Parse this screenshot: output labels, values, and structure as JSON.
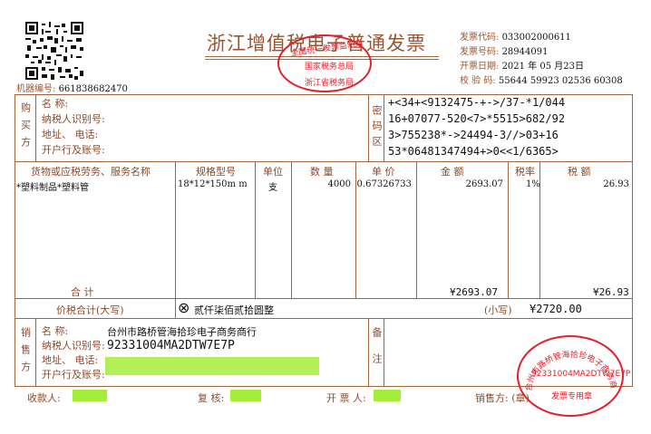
{
  "header": {
    "title": "浙江增值税电子普通发票",
    "machine_no_label": "机器编号:",
    "machine_no": "661838682470",
    "meta": [
      {
        "label": "发票代码:",
        "value": "033002000611"
      },
      {
        "label": "发票号码:",
        "value": "28944091"
      },
      {
        "label": "开票日期:",
        "value": "2021 年 05 月23日"
      },
      {
        "label": "校 验 码:",
        "value": "55644 59923 02536 60308"
      }
    ]
  },
  "buyer": {
    "section": "购买方",
    "labels": [
      "名      称:",
      "纳税人识别号:",
      "地址、 电话:",
      "开户行及账号:"
    ]
  },
  "cipher": {
    "section": "密码区",
    "lines": [
      "+<34+<9132475-+->/37-*1/044",
      "16+07077-520<7>*5515>682/92",
      "3>755238*->24494-3//>03+16",
      "53*06481347494+>0<<1/6365>"
    ]
  },
  "items": {
    "headers": [
      "货物或应税劳务、服务名称",
      "规格型号",
      "单位",
      "数 量",
      "单 价",
      "金 额",
      "税率",
      "税 额"
    ],
    "rows": [
      {
        "name": "*塑料制品*塑料管",
        "spec": "18*12*150m m",
        "unit": "支",
        "qty": "4000",
        "price": "0.67326733",
        "amount": "2693.07",
        "rate": "1%",
        "tax": "26.93"
      }
    ],
    "total_label": "合      计",
    "total_amount": "¥2693.07",
    "total_tax": "¥26.93"
  },
  "grand_total": {
    "label": "价税合计(大写)",
    "symbol": "⊗",
    "words": "贰仟柒佰贰拾圆整",
    "small_label": "(小写)",
    "small_value": "¥2720.00"
  },
  "seller": {
    "section": "销售方",
    "labels": [
      "名     称:",
      "纳税人识别号:",
      "地址、 电话:",
      "开户行及账号:"
    ],
    "name": "台州市路桥管海拾珍电子商务商行",
    "tax_id": "92331004MA2DTW7E7P"
  },
  "remarks": {
    "section": "备注"
  },
  "footer": {
    "payee": "收款人:",
    "reviewer": "复 核:",
    "drawer": "开 票 人:",
    "seller_seal": "销售方: (章)"
  },
  "stamp_top": {
    "lines": [
      "全国统一发票监制章",
      "国家税务总局",
      "浙江省税务局"
    ]
  },
  "stamp_bottom": {
    "ring": "台州市路桥管海拾珍电子商务商行",
    "tax_id": "92331004MA2DTW7E7P",
    "bottom": "发票专用章"
  },
  "colors": {
    "frame": "#a0663e",
    "stamp": "#e0202a",
    "redaction": "#a6ec3a"
  }
}
